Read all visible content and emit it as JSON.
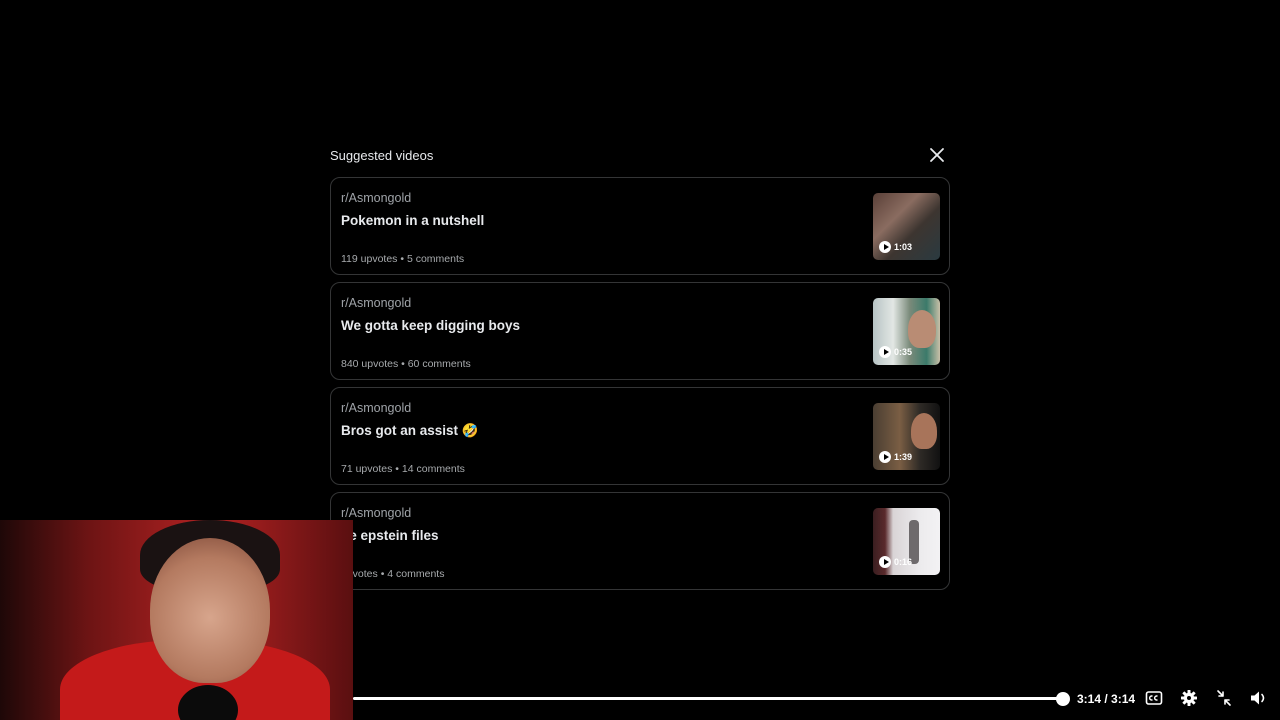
{
  "panel": {
    "title": "Suggested videos"
  },
  "videos": [
    {
      "subreddit": "r/Asmongold",
      "title": "Pokemon in a nutshell",
      "meta": "119 upvotes • 5 comments",
      "duration": "1:03"
    },
    {
      "subreddit": "r/Asmongold",
      "title": "We gotta keep digging boys",
      "meta": "840 upvotes • 60 comments",
      "duration": "0:35"
    },
    {
      "subreddit": "r/Asmongold",
      "title": "Bros got an assist 🤣",
      "meta": "71 upvotes • 14 comments",
      "duration": "1:39"
    },
    {
      "subreddit": "r/Asmongold",
      "title": "he epstein files",
      "meta": "upvotes • 4 comments",
      "duration": "0:16"
    }
  ],
  "player": {
    "time": "3:14 / 3:14",
    "progress": 1.0
  }
}
